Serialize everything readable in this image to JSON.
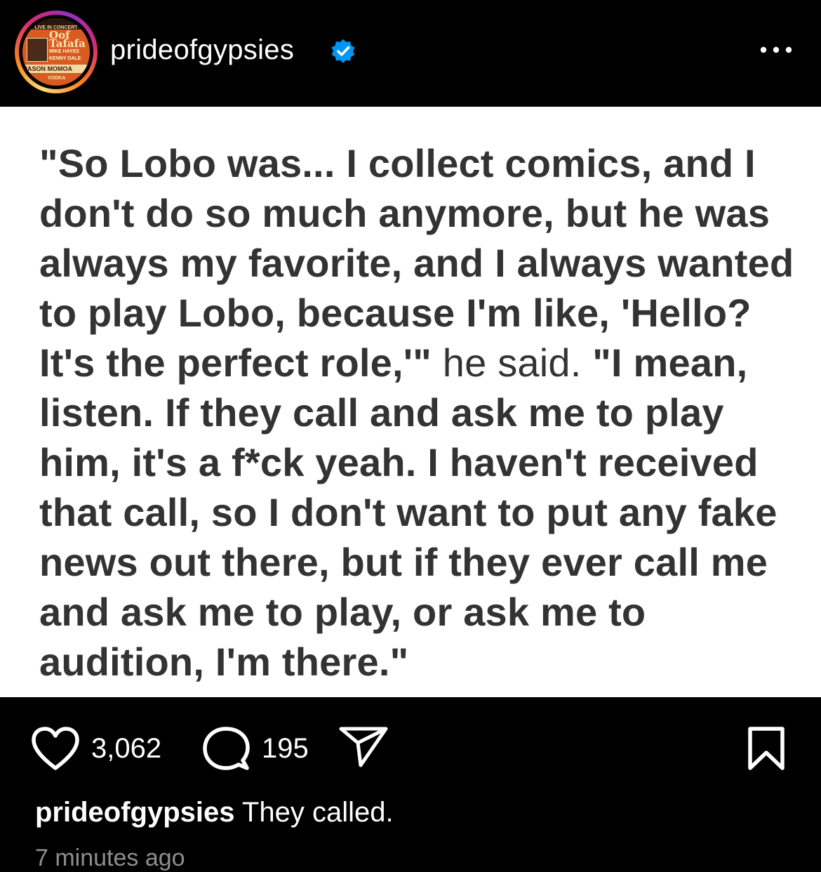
{
  "header": {
    "username": "prideofgypsies",
    "verified": true,
    "avatar": {
      "top_text": "LIVE IN CONCERT",
      "big_text": "Oof Tafafa",
      "line1": "MIKE HAYES",
      "line2": "KENNY DALE",
      "bottom_text": "JASON MOMOA",
      "small_text": "VODKA"
    },
    "more_icon": "more-horizontal-icon"
  },
  "post": {
    "quote_bold_1": "\"So Lobo was... I collect comics, and I don't do so much anymore, but he was always my favorite, and I always wanted to play Lobo, because I'm like, 'Hello? It's the perfect role,'\"",
    "quote_normal": " he said. ",
    "quote_bold_2": "\"I mean, listen. If they call and ask me to play him, it's a f*ck yeah. I haven't received that call, so I don't want to put any fake news out there, but if they ever call me and ask me to play, or ask me to audition, I'm there.\""
  },
  "actions": {
    "likes": "3,062",
    "comments": "195",
    "like_icon": "heart-icon",
    "comment_icon": "comment-icon",
    "share_icon": "send-icon",
    "save_icon": "bookmark-icon"
  },
  "caption": {
    "username": "prideofgypsies",
    "text": "They called."
  },
  "timestamp": "7 minutes ago",
  "colors": {
    "background": "#000000",
    "verified_blue": "#0095f6",
    "quote_text": "#333333"
  }
}
